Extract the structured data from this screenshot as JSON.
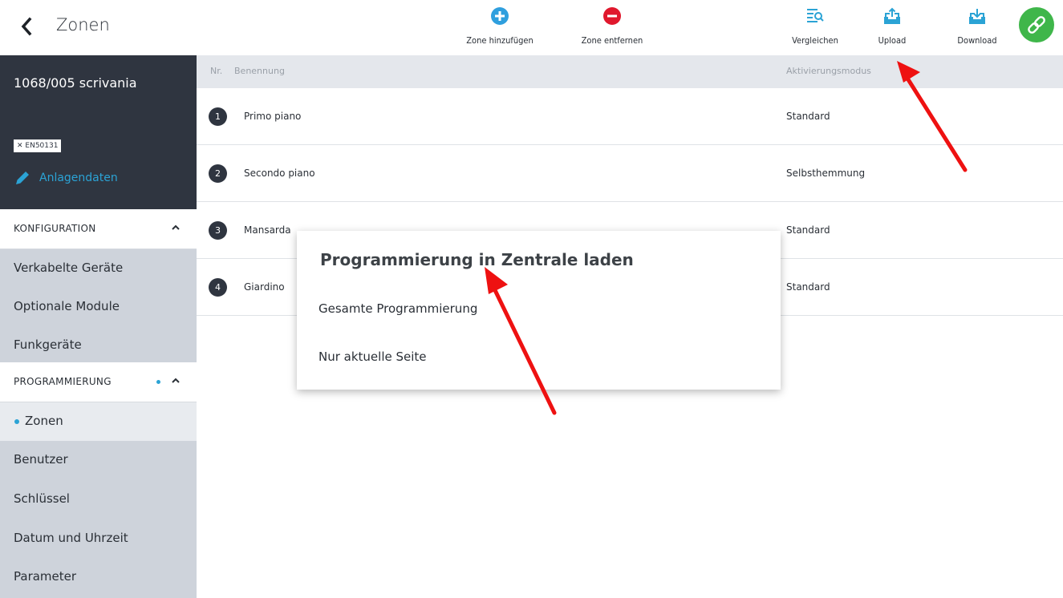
{
  "header": {
    "title": "Zonen",
    "toolbar": {
      "add_zone": "Zone hinzufügen",
      "remove_zone": "Zone entfernen",
      "compare": "Vergleichen",
      "upload": "Upload",
      "download": "Download"
    }
  },
  "sidebar": {
    "system_name": "1068/005 scrivania",
    "badge": "✕ EN50131",
    "edit_label": "Anlagendaten",
    "sections": {
      "config": {
        "label": "KONFIGURATION",
        "items": [
          "Verkabelte Geräte",
          "Optionale Module",
          "Funkgeräte"
        ]
      },
      "programming": {
        "label": "PROGRAMMIERUNG",
        "items": [
          "Zonen",
          "Benutzer",
          "Schlüssel",
          "Datum und Uhrzeit",
          "Parameter"
        ]
      }
    }
  },
  "table": {
    "headers": {
      "nr": "Nr.",
      "name": "Benennung",
      "mode": "Aktivierungsmodus"
    },
    "rows": [
      {
        "nr": "1",
        "name": "Primo piano",
        "mode": "Standard"
      },
      {
        "nr": "2",
        "name": "Secondo piano",
        "mode": "Selbsthemmung"
      },
      {
        "nr": "3",
        "name": "Mansarda",
        "mode": "Standard"
      },
      {
        "nr": "4",
        "name": "Giardino",
        "mode": "Standard"
      }
    ]
  },
  "dialog": {
    "title": "Programmierung in Zentrale laden",
    "options": [
      "Gesamte Programmierung",
      "Nur aktuelle Seite"
    ]
  },
  "colors": {
    "sidebar_dark": "#2f3540",
    "sidebar_light": "#ced3db",
    "accent_blue": "#2ba3d5",
    "add_icon": "#2f9fde",
    "remove_icon": "#e0182d",
    "link_button": "#3fb64a",
    "annotation_arrow": "#ee1111"
  },
  "icons": {
    "back": "chevron-left-icon",
    "add_zone": "plus-circle-icon",
    "remove_zone": "minus-circle-icon",
    "compare": "list-search-icon",
    "upload": "upload-tray-icon",
    "download": "download-tray-icon",
    "link": "link-icon",
    "edit": "pencil-icon"
  }
}
